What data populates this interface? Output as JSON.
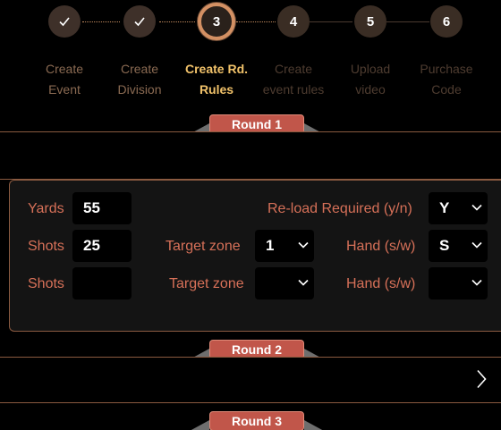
{
  "stepper": {
    "steps": [
      {
        "number": "1",
        "label_line1": "Create",
        "label_line2": "Event",
        "state": "done"
      },
      {
        "number": "2",
        "label_line1": "Create",
        "label_line2": "Division",
        "state": "done"
      },
      {
        "number": "3",
        "label_line1": "Create Rd.",
        "label_line2": "Rules",
        "state": "active"
      },
      {
        "number": "4",
        "label_line1": "Create",
        "label_line2": "event rules",
        "state": "todo"
      },
      {
        "number": "5",
        "label_line1": "Upload",
        "label_line2": "video",
        "state": "todo"
      },
      {
        "number": "6",
        "label_line1": "Purchase",
        "label_line2": "Code",
        "state": "todo"
      }
    ]
  },
  "rounds": {
    "round1": {
      "title": "Round 1",
      "rows": [
        {
          "label": "Yards",
          "value": "55",
          "right_label": "Re-load Required (y/n)",
          "right_value": "Y"
        },
        {
          "label": "Shots",
          "value": "25",
          "mid_label": "Target zone",
          "mid_value": "1",
          "right_label": "Hand (s/w)",
          "right_value": "S"
        },
        {
          "label": "Shots",
          "value": "",
          "mid_label": "Target zone",
          "mid_value": "",
          "right_label": "Hand (s/w)",
          "right_value": ""
        }
      ]
    },
    "round2": {
      "title": "Round 2"
    },
    "round3": {
      "title": "Round 3"
    }
  },
  "colors": {
    "accent": "#d39063",
    "label": "#d67058",
    "active_step": "#f1c26a",
    "tab": "#c1564a"
  }
}
